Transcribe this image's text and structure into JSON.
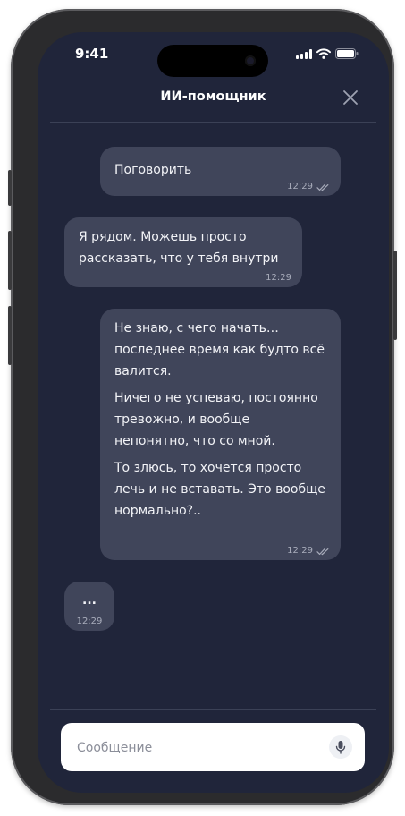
{
  "status_bar": {
    "time": "9:41"
  },
  "header": {
    "title": "ИИ-помощник"
  },
  "messages": [
    {
      "direction": "outgoing",
      "paragraphs": [
        "Поговорить"
      ],
      "time": "12:29",
      "read": true
    },
    {
      "direction": "incoming",
      "paragraphs": [
        "Я рядом. Можешь просто рассказать, что у тебя внутри"
      ],
      "time": "12:29"
    },
    {
      "direction": "outgoing",
      "paragraphs": [
        "Не знаю, с чего начать… последнее время как будто всё валится.",
        "Ничего не успеваю, постоянно тревожно, и вообще непонятно, что со мной.",
        "То злюсь, то хочется просто лечь и не вставать. Это вообще нормально?.."
      ],
      "time": "12:29",
      "read": true
    },
    {
      "direction": "incoming",
      "paragraphs": [
        "..."
      ],
      "time": "12:29"
    }
  ],
  "composer": {
    "placeholder": "Сообщение"
  },
  "colors": {
    "background": "#20253a",
    "bubble": "#40455a",
    "text": "#f2f3f7",
    "meta": "#a8acbb"
  },
  "icons": [
    "close-icon",
    "double-check-icon",
    "microphone-icon",
    "signal-icon",
    "wifi-icon",
    "battery-icon"
  ]
}
